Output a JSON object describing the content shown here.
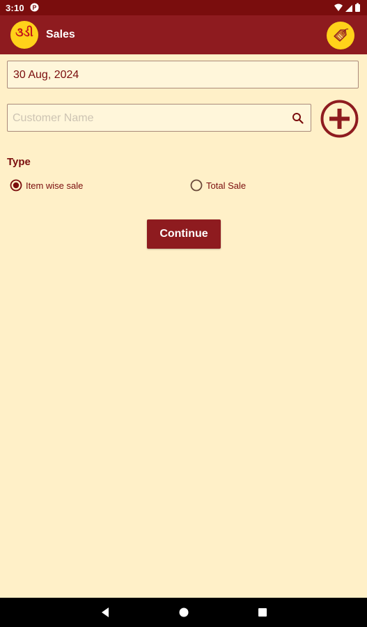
{
  "status_bar": {
    "time": "3:10"
  },
  "app_bar": {
    "logo_text": "૩ડી",
    "title": "Sales"
  },
  "form": {
    "date_value": "30 Aug, 2024",
    "customer_placeholder": "Customer Name",
    "customer_value": "",
    "type_label": "Type",
    "type_options": [
      {
        "label": "Item wise sale",
        "selected": true
      },
      {
        "label": "Total Sale",
        "selected": false
      }
    ],
    "continue_label": "Continue"
  },
  "colors": {
    "primary": "#8e1b1f",
    "status_bar": "#7a0d0d",
    "background": "#fff0c8",
    "accent_yellow": "#ffd21a"
  },
  "icons": {
    "tag": "tag-icon",
    "search": "search-icon",
    "add": "add-circle-icon",
    "back": "back-icon",
    "home": "home-icon",
    "recents": "recents-icon"
  }
}
